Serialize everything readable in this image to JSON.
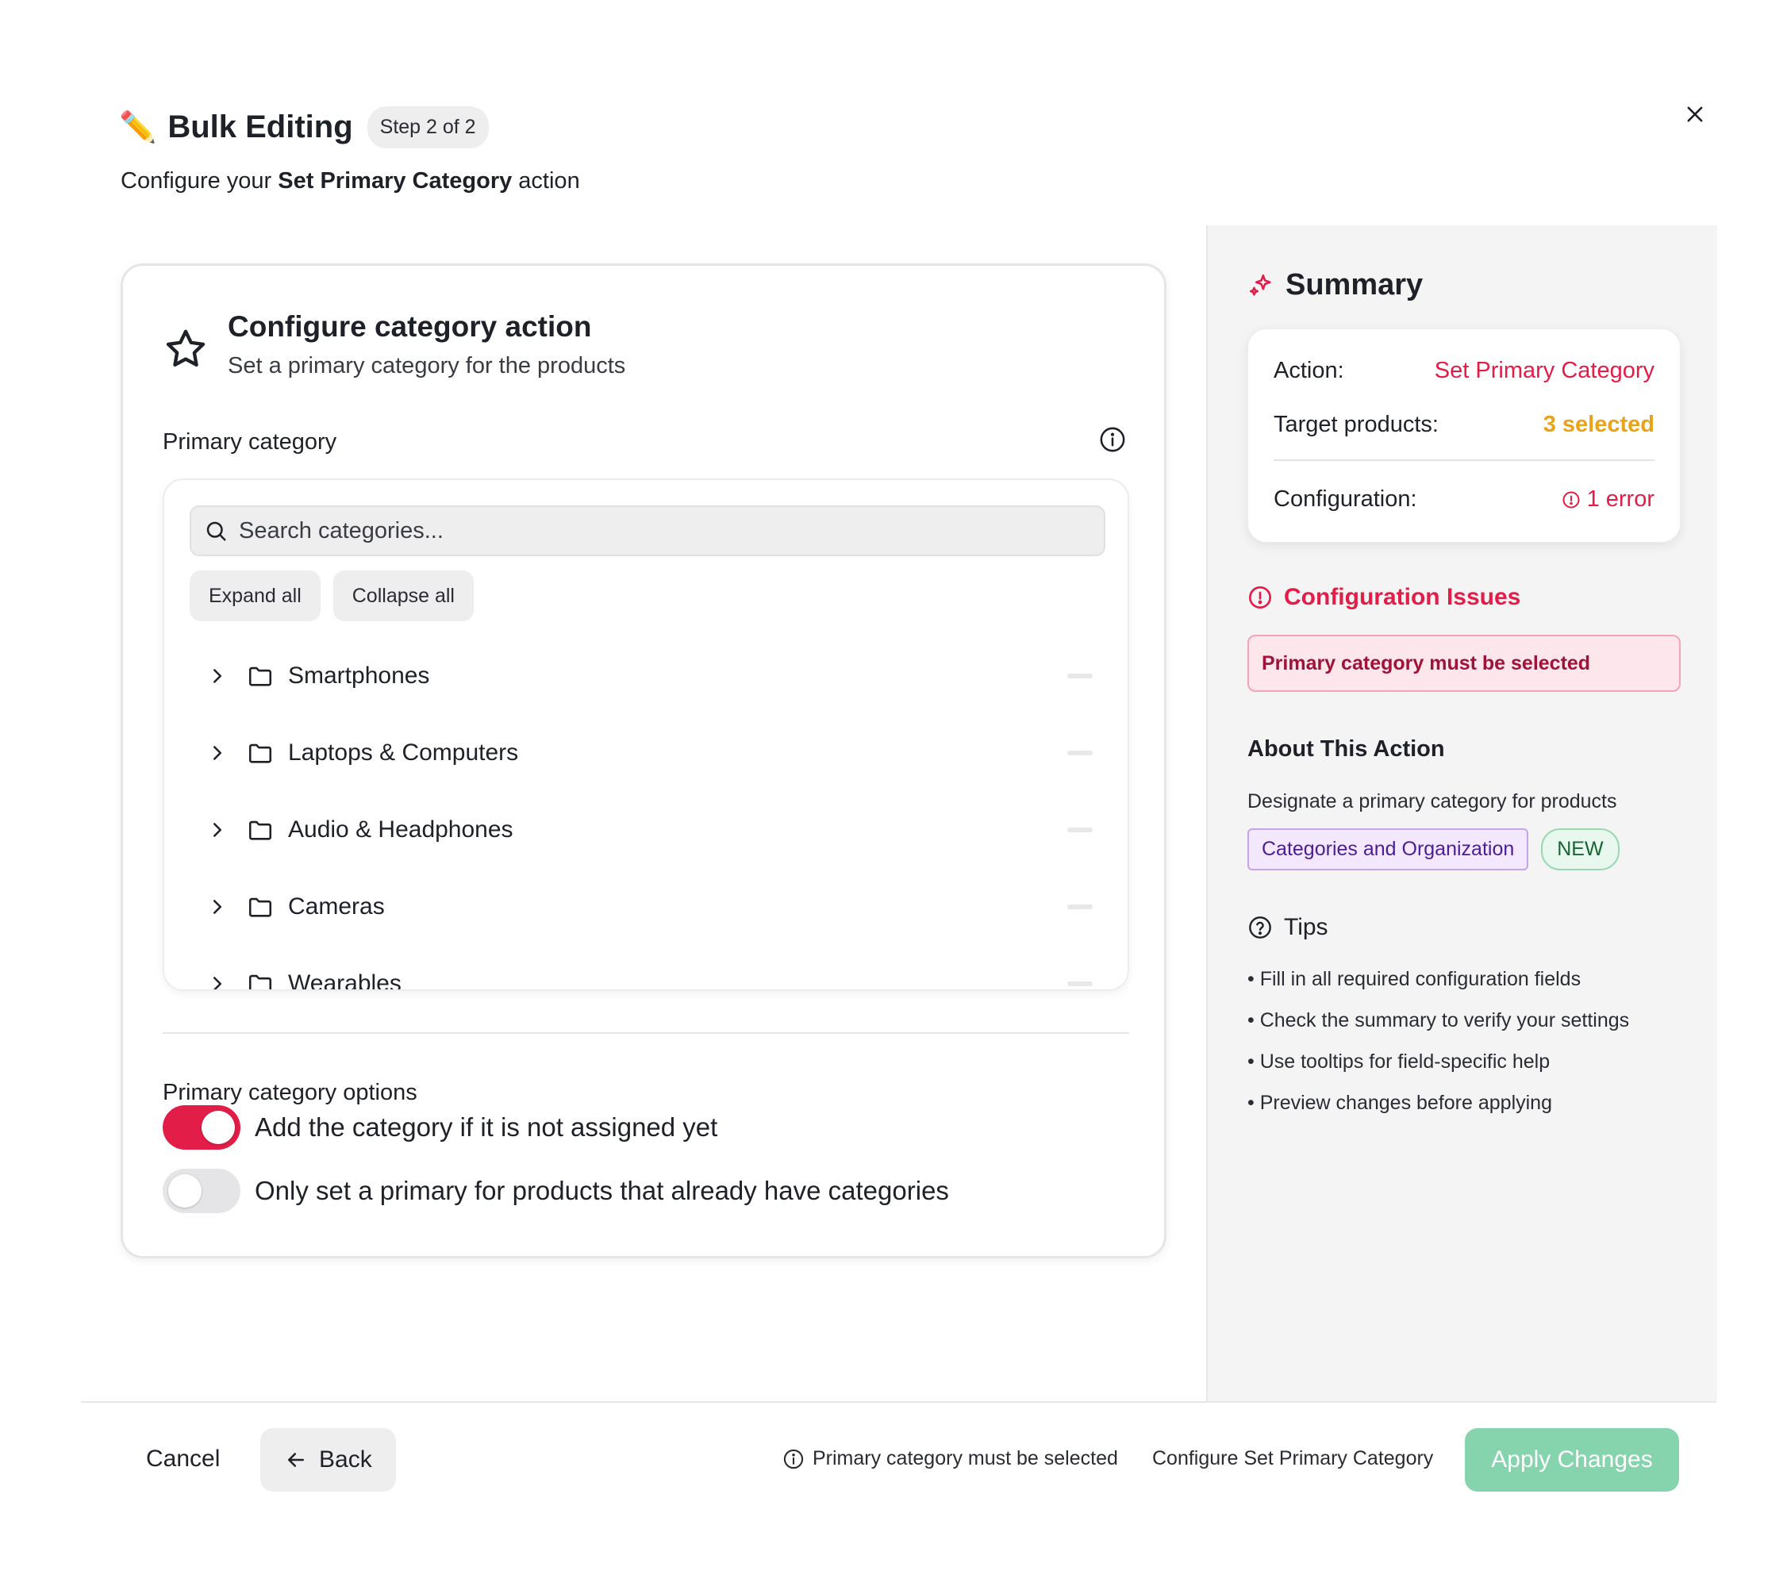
{
  "header": {
    "pencil_icon": "pencil-icon",
    "title": "Bulk Editing",
    "step": "Step 2 of 2",
    "subtitle_prefix": "Configure your ",
    "subtitle_bold": "Set Primary Category",
    "subtitle_suffix": " action"
  },
  "card": {
    "title": "Configure category action",
    "subtitle": "Set a primary category for the products",
    "field_label": "Primary category",
    "search_placeholder": "Search categories...",
    "expand_all": "Expand all",
    "collapse_all": "Collapse all",
    "categories": [
      "Smartphones",
      "Laptops & Computers",
      "Audio & Headphones",
      "Cameras",
      "Wearables"
    ],
    "options_label": "Primary category options",
    "option_add": "Add the category if it is not assigned yet",
    "option_add_on": true,
    "option_only": "Only set a primary for products that already have categories",
    "option_only_on": false
  },
  "summary": {
    "title": "Summary",
    "action_key": "Action:",
    "action_value": "Set Primary Category",
    "target_key": "Target products:",
    "target_value": "3 selected",
    "config_key": "Configuration:",
    "config_value": "1 error"
  },
  "issues": {
    "title": "Configuration Issues",
    "message": "Primary category must be selected"
  },
  "about": {
    "title": "About This Action",
    "description": "Designate a primary category for products",
    "tag_category": "Categories and Organization",
    "tag_new": "NEW"
  },
  "tips": {
    "title": "Tips",
    "items": [
      "• Fill in all required configuration fields",
      "• Check the summary to verify your settings",
      "• Use tooltips for field-specific help",
      "• Preview changes before applying"
    ]
  },
  "footer": {
    "cancel": "Cancel",
    "back": "Back",
    "validation": "Primary category must be selected",
    "configure": "Configure Set Primary Category",
    "apply": "Apply Changes"
  },
  "colors": {
    "accent": "#e11d48",
    "warning": "#e8a317",
    "apply_disabled": "#86d4ae"
  }
}
